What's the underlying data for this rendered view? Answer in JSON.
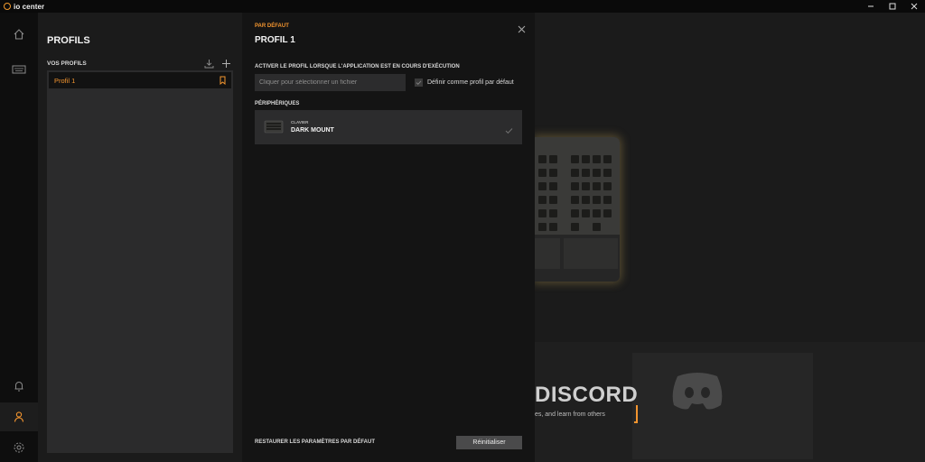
{
  "app": {
    "name": "io center"
  },
  "window_controls": [
    "minimize-icon",
    "maximize-icon",
    "close-icon"
  ],
  "rail": {
    "items": [
      {
        "name": "home-icon"
      },
      {
        "name": "keyboard-icon"
      },
      {
        "name": "bell-icon"
      },
      {
        "name": "user-icon",
        "active": true
      },
      {
        "name": "gear-icon"
      }
    ]
  },
  "profiles_panel": {
    "title": "PROFILS",
    "section_label": "VOS PROFILS",
    "actions": [
      "download-icon",
      "plus-icon"
    ],
    "items": [
      {
        "label": "Profil 1",
        "selected": true
      }
    ]
  },
  "detail": {
    "eyebrow": "PAR DÉFAUT",
    "title": "PROFIL 1",
    "activate_label": "ACTIVER LE PROFIL LORSQUE L'APPLICATION EST EN COURS D'EXÉCUTION",
    "file_placeholder": "Cliquer pour sélectionner un fichier",
    "default_checkbox_label": "Définir comme profil par défaut",
    "devices_label": "PÉRIPHÉRIQUES",
    "device": {
      "type": "CLAVIER",
      "name": "DARK MOUNT"
    },
    "restore_label": "RESTAURER LES PARAMÈTRES PAR DÉFAUT",
    "reset_button": "Réinitialiser"
  },
  "background": {
    "banner_title": "DISCORD",
    "banner_subtitle": "es, and learn from others"
  },
  "colors": {
    "accent": "#f3952f",
    "panel": "#1b1b1b",
    "detail_bg": "#141414"
  }
}
